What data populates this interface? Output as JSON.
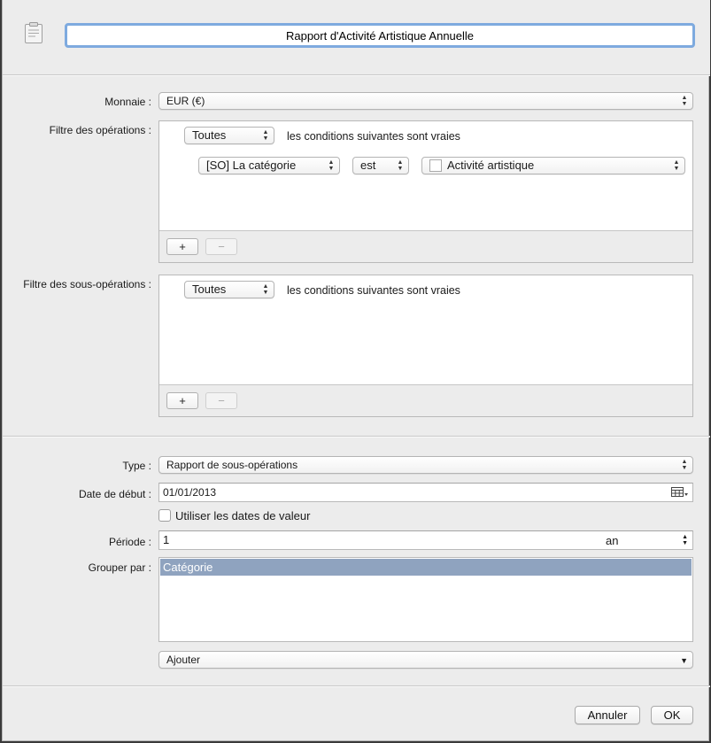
{
  "header": {
    "icon": "clipboard-icon",
    "report_name": "Rapport d'Activité Artistique Annuelle"
  },
  "currency": {
    "label": "Monnaie :",
    "value": "EUR (€)"
  },
  "operations_filter": {
    "label": "Filtre des opérations :",
    "match": "Toutes",
    "match_suffix": "les conditions suivantes sont vraies",
    "rule": {
      "field": "[SO] La catégorie",
      "operator": "est",
      "value": "Activité artistique"
    },
    "add_label": "+",
    "remove_label": "−"
  },
  "suboperations_filter": {
    "label": "Filtre des sous-opérations :",
    "match": "Toutes",
    "match_suffix": "les conditions suivantes sont vraies",
    "add_label": "+",
    "remove_label": "−"
  },
  "type": {
    "label": "Type :",
    "value": "Rapport de sous-opérations"
  },
  "start_date": {
    "label": "Date de début :",
    "value": "01/01/2013",
    "icon": "calendar-icon"
  },
  "value_dates": {
    "label": "Utiliser les dates de valeur",
    "checked": false
  },
  "period": {
    "label": "Période :",
    "value": "1",
    "unit": "an"
  },
  "group_by": {
    "label": "Grouper par :",
    "items": [
      "Catégorie"
    ],
    "add_popup": "Ajouter"
  },
  "footer": {
    "cancel": "Annuler",
    "ok": "OK"
  },
  "colors": {
    "selection": "#8fa3bf",
    "focus_ring": "#7eaadf"
  }
}
